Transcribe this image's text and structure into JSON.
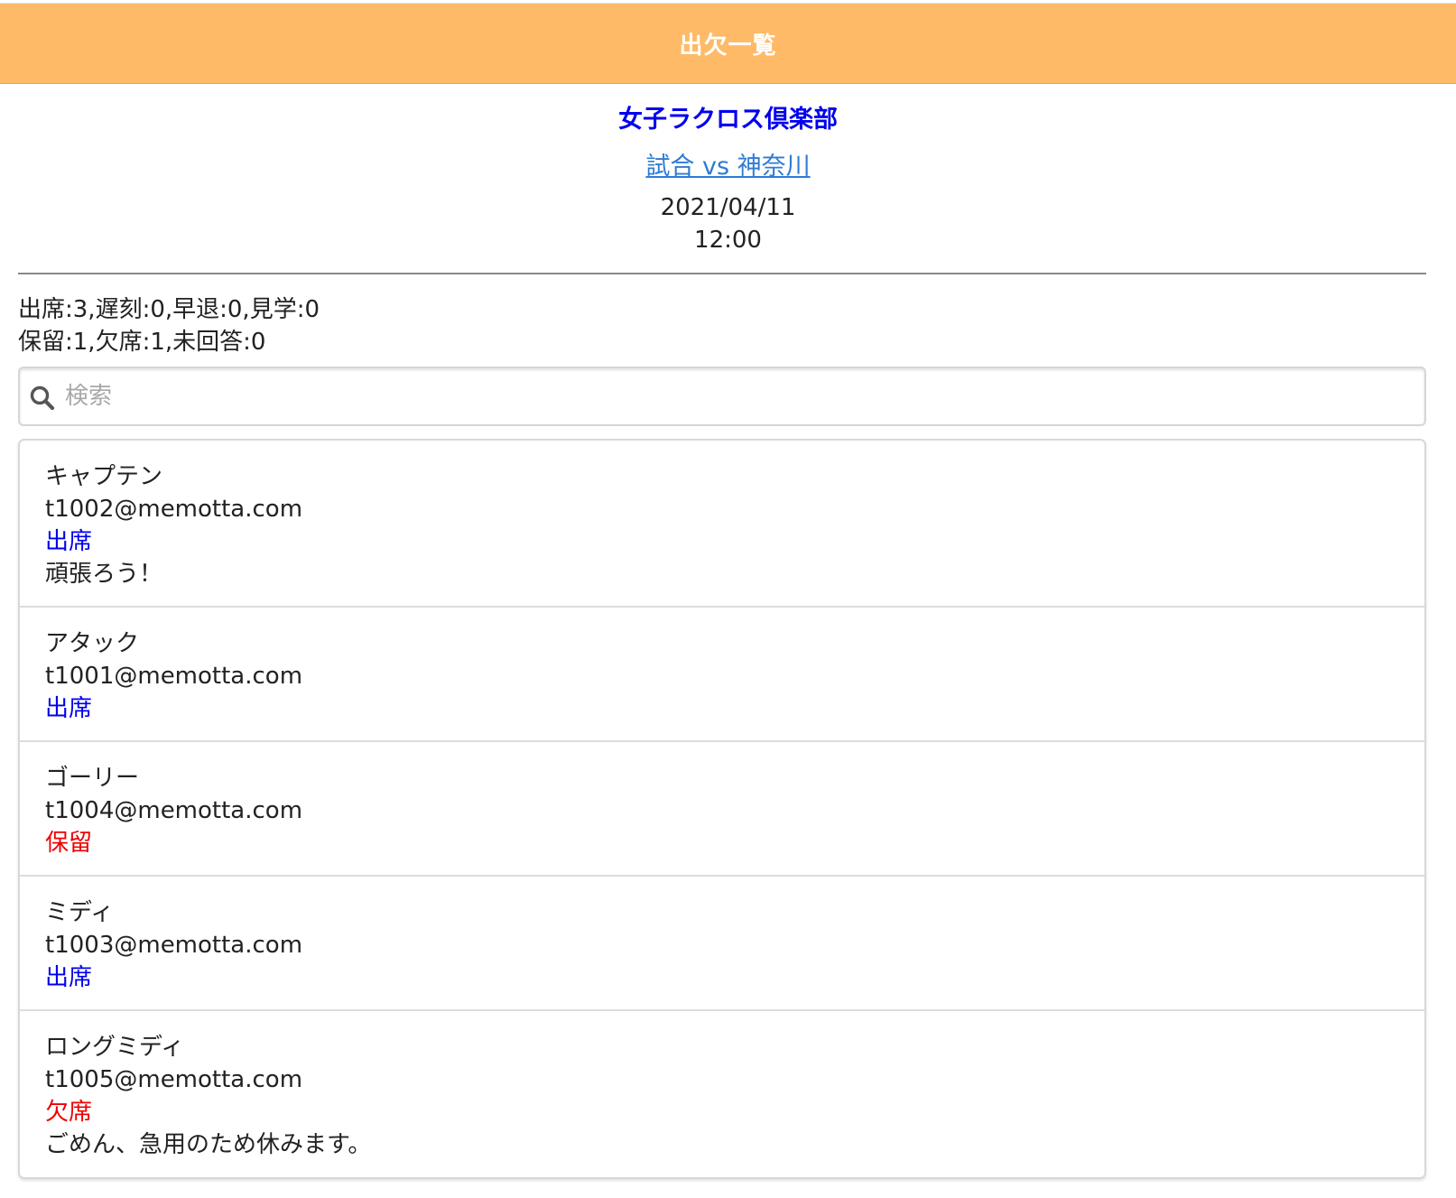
{
  "header": {
    "title": "出欠一覧",
    "bg_color": "#ffba68"
  },
  "organization": {
    "name": "女子ラクロス倶楽部"
  },
  "event": {
    "title": "試合 vs 神奈川",
    "date": "2021/04/11",
    "time": "12:00"
  },
  "summary": {
    "line1": "出席:3,遅刻:0,早退:0,見学:0",
    "line2": "保留:1,欠席:1,未回答:0"
  },
  "search": {
    "placeholder": "検索",
    "value": "",
    "icon": "search-icon"
  },
  "members": [
    {
      "name": "キャプテン",
      "email": "t1002@memotta.com",
      "status": "出席",
      "comment": "頑張ろう！"
    },
    {
      "name": "アタック",
      "email": "t1001@memotta.com",
      "status": "出席",
      "comment": ""
    },
    {
      "name": "ゴーリー",
      "email": "t1004@memotta.com",
      "status": "保留",
      "comment": ""
    },
    {
      "name": "ミディ",
      "email": "t1003@memotta.com",
      "status": "出席",
      "comment": ""
    },
    {
      "name": "ロングミディ",
      "email": "t1005@memotta.com",
      "status": "欠席",
      "comment": "ごめん、急用のため休みます。"
    }
  ],
  "colors": {
    "present": "#0000ee",
    "pending": "#ee0000",
    "absent": "#ee0000",
    "link": "#2f7bd3"
  }
}
